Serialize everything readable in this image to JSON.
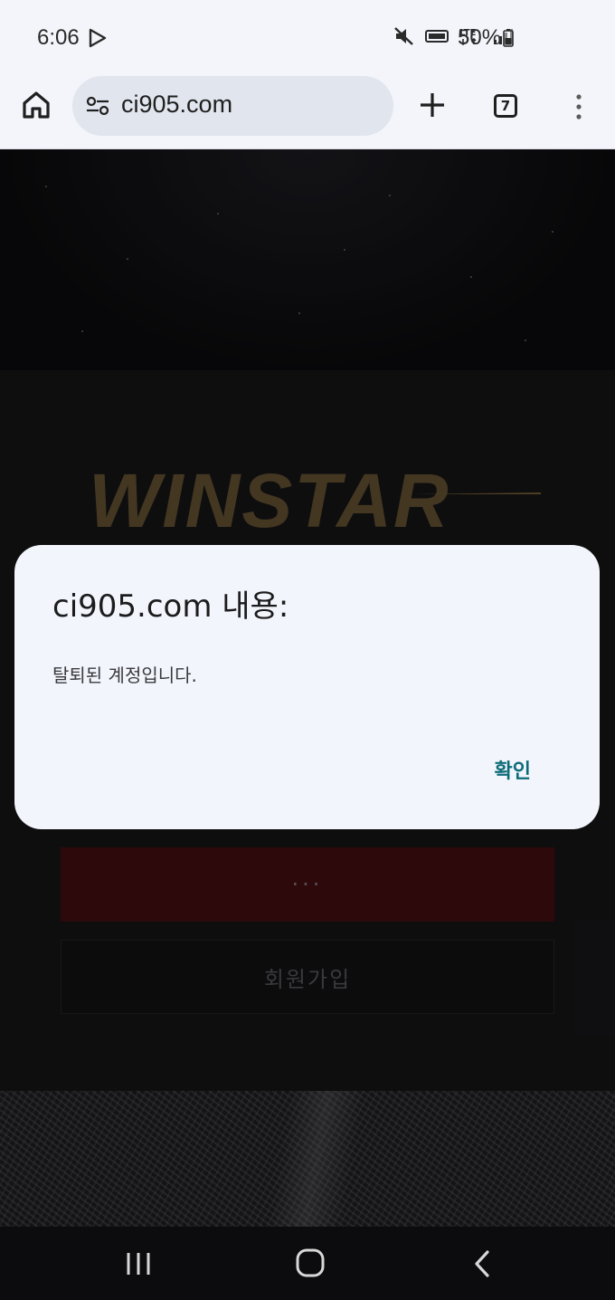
{
  "status_bar": {
    "time": "6:06",
    "battery": "50%",
    "icons": [
      "play-store-icon",
      "mute-icon",
      "volte-icon",
      "lte-icon",
      "signal-icon",
      "battery-icon"
    ]
  },
  "browser": {
    "url": "ci905.com",
    "tab_count": "7",
    "icons": [
      "home-icon",
      "site-settings-icon",
      "plus-icon",
      "menu-dots-icon"
    ]
  },
  "page": {
    "logo_text": "WINSTAR",
    "login_button_label": "···",
    "signup_button_label": "회원가입"
  },
  "dialog": {
    "title": "ci905.com 내용:",
    "message": "탈퇴된 계정입니다.",
    "ok_label": "확인"
  },
  "nav_bar": {
    "icons": [
      "recent-apps-icon",
      "home-button-icon",
      "back-icon"
    ]
  },
  "colors": {
    "dialog_bg": "#f2f5fb",
    "accent": "#0d6b78",
    "login_button": "#3d0c10",
    "logo": "#5a4a2c"
  }
}
